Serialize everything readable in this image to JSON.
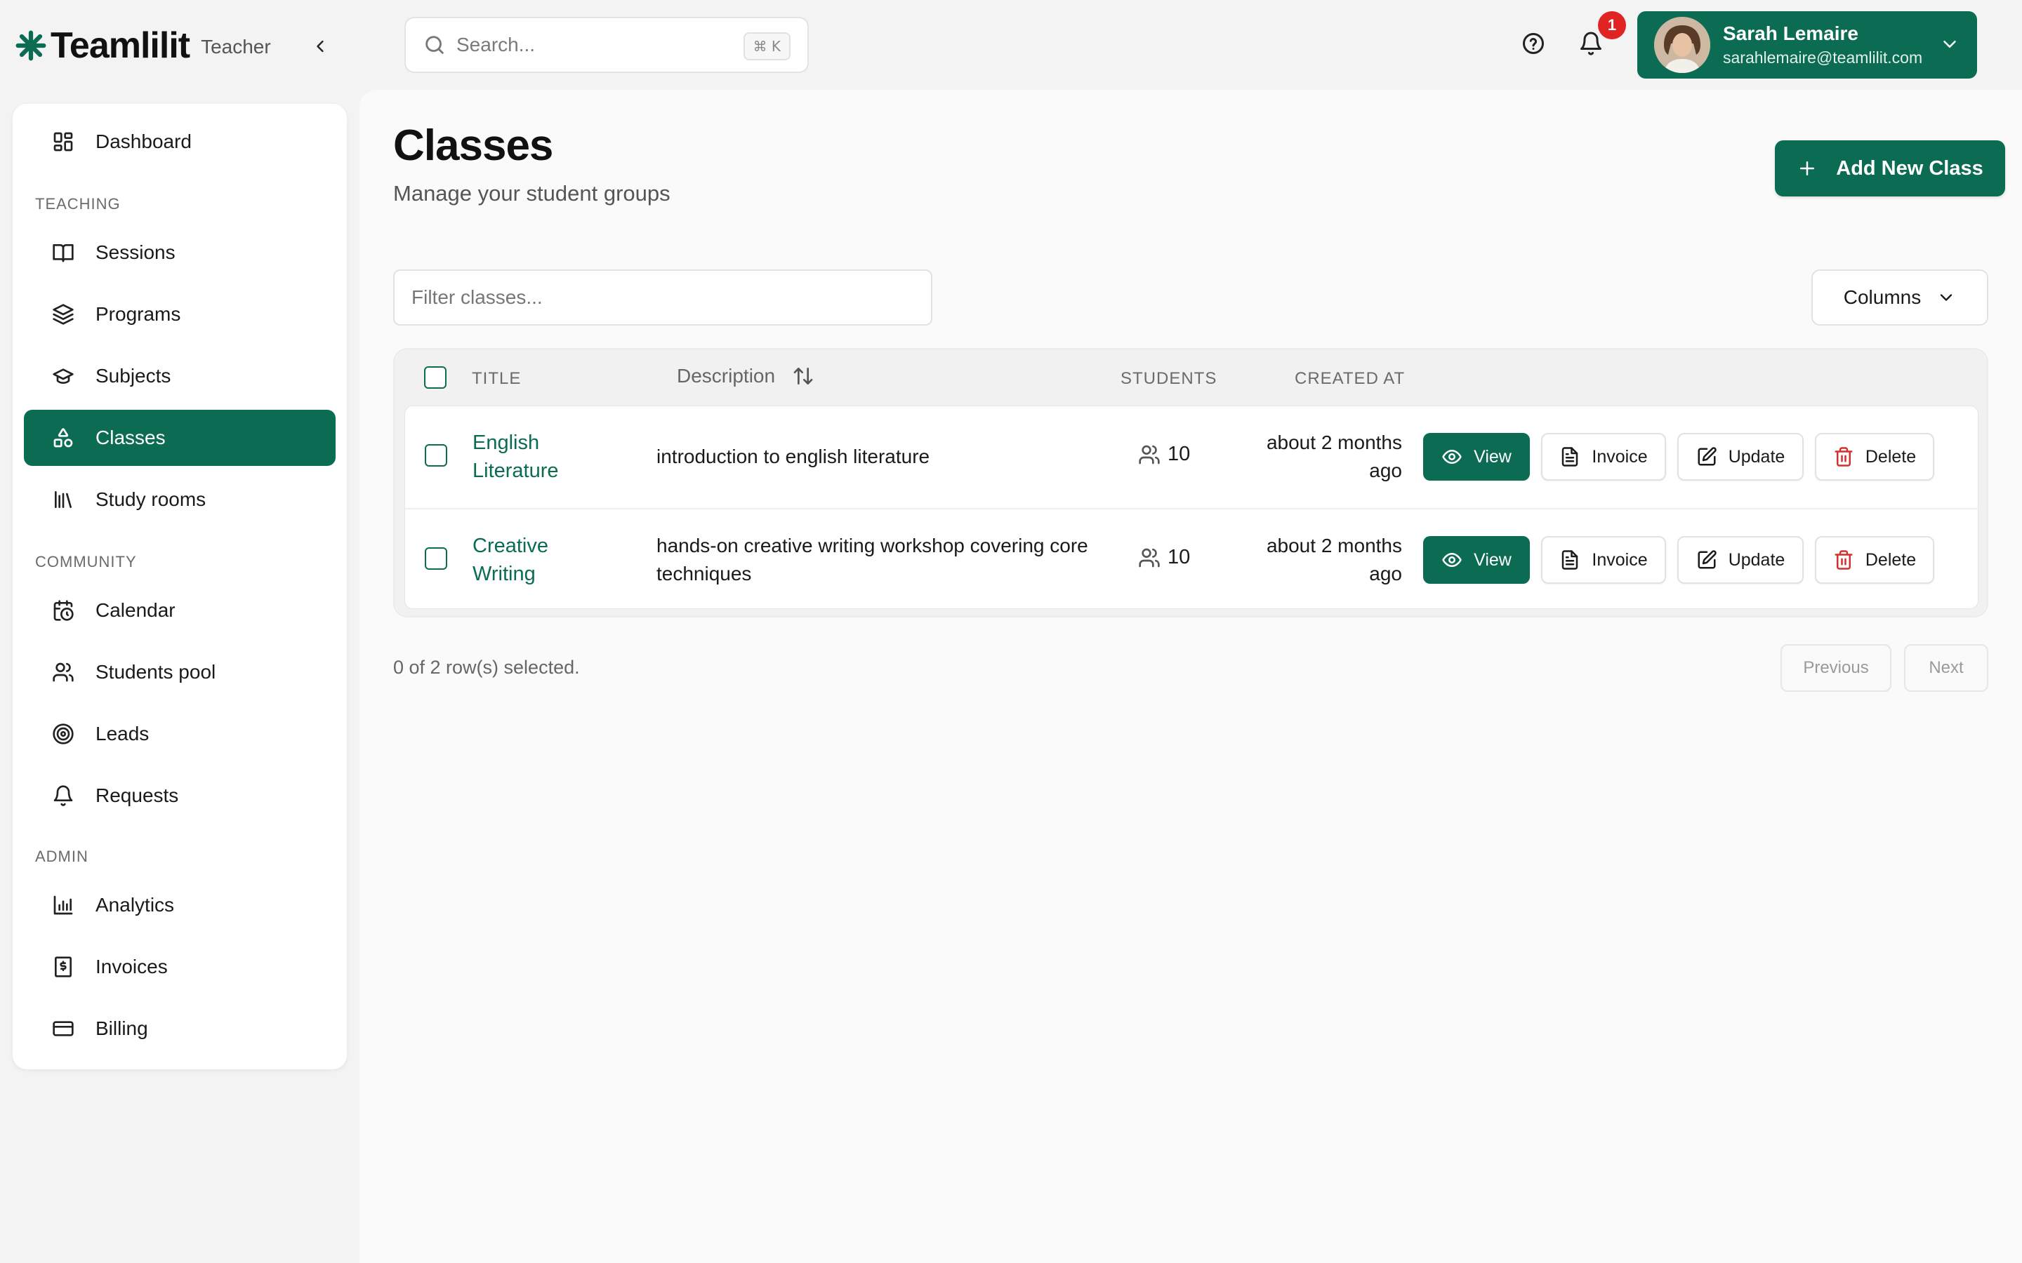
{
  "brand": {
    "name": "Teamlilit",
    "role": "Teacher"
  },
  "search": {
    "placeholder": "Search...",
    "shortcut": "⌘ K"
  },
  "notifications": {
    "count": "1"
  },
  "user": {
    "name": "Sarah Lemaire",
    "email": "sarahlemaire@teamlilit.com"
  },
  "sidebar": {
    "dashboard": "Dashboard",
    "sections": {
      "teaching": "TEACHING",
      "community": "COMMUNITY",
      "admin": "ADMIN"
    },
    "items": [
      {
        "label": "Sessions",
        "icon": "book-open-icon"
      },
      {
        "label": "Programs",
        "icon": "layers-icon"
      },
      {
        "label": "Subjects",
        "icon": "graduation-cap-icon"
      },
      {
        "label": "Classes",
        "icon": "shapes-icon",
        "active": true
      },
      {
        "label": "Study rooms",
        "icon": "library-icon"
      },
      {
        "label": "Calendar",
        "icon": "calendar-clock-icon"
      },
      {
        "label": "Students pool",
        "icon": "users-icon"
      },
      {
        "label": "Leads",
        "icon": "target-icon"
      },
      {
        "label": "Requests",
        "icon": "bell-icon"
      },
      {
        "label": "Analytics",
        "icon": "bar-chart-icon"
      },
      {
        "label": "Invoices",
        "icon": "receipt-icon"
      },
      {
        "label": "Billing",
        "icon": "credit-card-icon"
      }
    ]
  },
  "page": {
    "title": "Classes",
    "subtitle": "Manage your student groups",
    "add_button": "Add New Class",
    "filter_placeholder": "Filter classes...",
    "columns_button": "Columns"
  },
  "table": {
    "headers": {
      "title": "TITLE",
      "description": "Description",
      "students": "STUDENTS",
      "created_at": "CREATED AT"
    },
    "rows": [
      {
        "title_line1": "English",
        "title_line2": "Literature",
        "description": "introduction to english literature",
        "students": "10",
        "created_line1": "about 2 months",
        "created_line2": "ago"
      },
      {
        "title_line1": "Creative",
        "title_line2": "Writing",
        "description": "hands-on creative writing workshop covering core techniques",
        "students": "10",
        "created_line1": "about 2 months",
        "created_line2": "ago"
      }
    ],
    "actions": {
      "view": "View",
      "invoice": "Invoice",
      "update": "Update",
      "delete": "Delete"
    }
  },
  "footer": {
    "selected": "0 of 2 row(s) selected.",
    "previous": "Previous",
    "next": "Next"
  },
  "colors": {
    "brand": "#0b6b53",
    "danger": "#d32f2f",
    "badge": "#e02424"
  }
}
